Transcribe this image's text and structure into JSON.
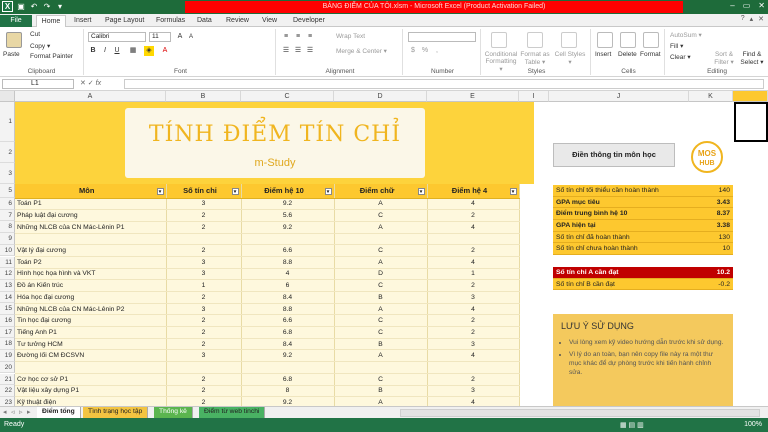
{
  "window": {
    "title": "BẢNG ĐIỂM CỦA TÔI.xlsm - Microsoft Excel (Product Activation Failed)"
  },
  "ribbon_tabs": [
    "File",
    "Home",
    "Insert",
    "Page Layout",
    "Formulas",
    "Data",
    "Review",
    "View",
    "Developer"
  ],
  "ribbon": {
    "clipboard": {
      "paste": "Paste",
      "cut": "Cut",
      "copy": "Copy ▾",
      "format_painter": "Format Painter",
      "label": "Clipboard"
    },
    "font": {
      "name": "Calibri",
      "size": "11",
      "label": "Font"
    },
    "alignment": {
      "wrap": "Wrap Text",
      "merge": "Merge & Center ▾",
      "label": "Alignment"
    },
    "number": {
      "format": "",
      "label": "Number"
    },
    "styles": {
      "conditional": "Conditional Formatting ▾",
      "format_table": "Format as Table ▾",
      "cell_styles": "Cell Styles ▾",
      "label": "Styles"
    },
    "cells": {
      "insert": "Insert",
      "delete": "Delete",
      "format": "Format",
      "label": "Cells"
    },
    "editing": {
      "autosum": "AutoSum ▾",
      "fill": "Fill ▾",
      "clear": "Clear ▾",
      "sort": "Sort & Filter ▾",
      "find": "Find & Select ▾",
      "label": "Editing"
    }
  },
  "formula_bar": {
    "cell_ref": "L1",
    "fx": "fx",
    "value": ""
  },
  "columns": [
    "A",
    "B",
    "C",
    "D",
    "E",
    "I",
    "J",
    "K"
  ],
  "rows": [
    "1",
    "2",
    "3",
    "4",
    "5",
    "6",
    "7",
    "8",
    "9",
    "10",
    "11",
    "12",
    "13",
    "14",
    "15",
    "16",
    "17",
    "18",
    "19",
    "20",
    "21",
    "22",
    "23"
  ],
  "banner": {
    "title": "TÍNH ĐIỂM TÍN CHỈ",
    "subtitle": "m-Study"
  },
  "table": {
    "headers": [
      "Môn",
      "Số tín chỉ",
      "Điểm hệ 10",
      "Điểm chữ",
      "Điểm hệ 4"
    ],
    "rows": [
      [
        "Toán P1",
        "3",
        "9.2",
        "A",
        "4"
      ],
      [
        "Pháp luật đại cương",
        "2",
        "5.6",
        "C",
        "2"
      ],
      [
        "Những NLCB của CN Mác-Lênin P1",
        "2",
        "9.2",
        "A",
        "4"
      ],
      [
        "",
        "",
        "",
        "",
        ""
      ],
      [
        "Vật lý đại cương",
        "2",
        "6.6",
        "C",
        "2"
      ],
      [
        "Toán P2",
        "3",
        "8.8",
        "A",
        "4"
      ],
      [
        "Hình học họa hình và VKT",
        "3",
        "4",
        "D",
        "1"
      ],
      [
        "Đồ án Kiến trúc",
        "1",
        "6",
        "C",
        "2"
      ],
      [
        "Hóa học đại cương",
        "2",
        "8.4",
        "B",
        "3"
      ],
      [
        "Những NLCB của CN Mác-Lênin P2",
        "3",
        "8.8",
        "A",
        "4"
      ],
      [
        "Tin học đại cương",
        "2",
        "6.6",
        "C",
        "2"
      ],
      [
        "Tiếng Anh P1",
        "2",
        "6.8",
        "C",
        "2"
      ],
      [
        "Tư tưởng HCM",
        "2",
        "8.4",
        "B",
        "3"
      ],
      [
        "Đường lối CM ĐCSVN",
        "3",
        "9.2",
        "A",
        "4"
      ],
      [
        "",
        "",
        "",
        "",
        ""
      ],
      [
        "Cơ học cơ sở P1",
        "2",
        "6.8",
        "C",
        "2"
      ],
      [
        "Vật liệu xây dựng P1",
        "2",
        "8",
        "B",
        "3"
      ],
      [
        "Kỹ thuật điện",
        "2",
        "9.2",
        "A",
        "4"
      ]
    ]
  },
  "panel": {
    "button": "Điền thông tin môn học",
    "logo_top": "MOS",
    "logo_bottom": "HUB",
    "stats": [
      {
        "label": "Số tín chỉ tối thiểu cần hoàn thành",
        "value": "140",
        "bold": false
      },
      {
        "label": "GPA mục tiêu",
        "value": "3.43",
        "bold": true
      },
      {
        "label": "Điểm trung bình hệ 10",
        "value": "8.37",
        "bold": true
      },
      {
        "label": "GPA hiện tại",
        "value": "3.38",
        "bold": true
      },
      {
        "label": "Số tín chỉ đã hoàn thành",
        "value": "130",
        "bold": false
      },
      {
        "label": "Số tín chỉ chưa hoàn thành",
        "value": "10",
        "bold": false
      }
    ],
    "need_a": {
      "label": "Số tín chỉ A cần đạt",
      "value": "10.2"
    },
    "need_b": {
      "label": "Số tín chỉ B cần đạt",
      "value": "-0.2"
    },
    "note_title": "LƯU Ý SỬ DỤNG",
    "notes": [
      "Vui lòng xem kỹ video hướng dẫn trước khi sử dụng.",
      "Vì lý do an toàn, bạn nên copy file này ra một thư mục khác để dự phòng trước khi tiến hành chỉnh sửa."
    ]
  },
  "sheet_tabs": [
    "Điểm tổng",
    "Tình trạng học tập",
    "Thống kê",
    "Điểm từ web tinchi"
  ],
  "status": {
    "left": "Ready",
    "zoom": "100%"
  },
  "colors": {
    "accent": "#217346",
    "yellow": "#fdc82f",
    "red": "#c00000"
  }
}
